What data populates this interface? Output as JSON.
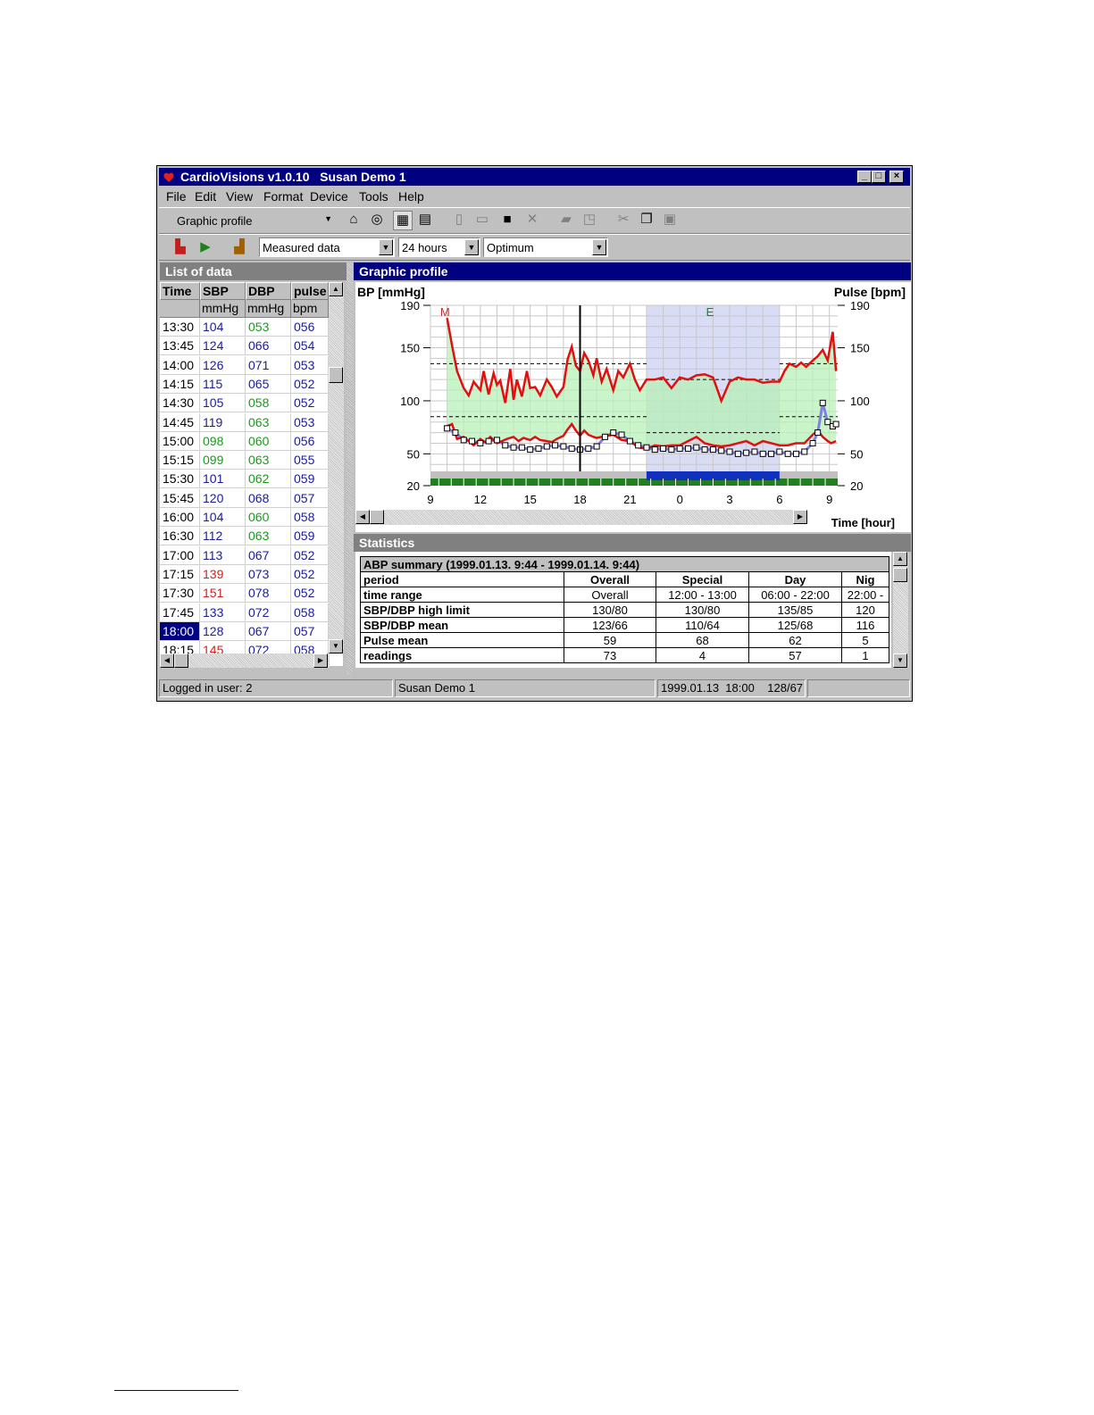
{
  "window": {
    "title": "CardioVisions v1.0.10   Susan Demo 1"
  },
  "menu": [
    "File",
    "Edit",
    "View",
    "Format",
    "Device",
    "Tools",
    "Help"
  ],
  "toolbar": {
    "view_combo": "Graphic profile",
    "data_combo": "Measured data",
    "range_combo": "24 hours",
    "limit_combo": "Optimum"
  },
  "list_panel": {
    "title": "List of data",
    "headers": [
      "Time",
      "SBP",
      "DBP",
      "pulse"
    ],
    "units": [
      "",
      "mmHg",
      "mmHg",
      "bpm"
    ],
    "rows": [
      {
        "time": "13:30",
        "sbp": "104",
        "dbp": "053",
        "pulse": "056",
        "sc": "#1a1aa0",
        "dc": "#1a9a1a"
      },
      {
        "time": "13:45",
        "sbp": "124",
        "dbp": "066",
        "pulse": "054",
        "sc": "#1a1aa0",
        "dc": "#1a1aa0"
      },
      {
        "time": "14:00",
        "sbp": "126",
        "dbp": "071",
        "pulse": "053",
        "sc": "#1a1aa0",
        "dc": "#1a1aa0"
      },
      {
        "time": "14:15",
        "sbp": "115",
        "dbp": "065",
        "pulse": "052",
        "sc": "#1a1aa0",
        "dc": "#1a1aa0"
      },
      {
        "time": "14:30",
        "sbp": "105",
        "dbp": "058",
        "pulse": "052",
        "sc": "#1a1aa0",
        "dc": "#1a9a1a"
      },
      {
        "time": "14:45",
        "sbp": "119",
        "dbp": "063",
        "pulse": "053",
        "sc": "#1a1aa0",
        "dc": "#1a9a1a"
      },
      {
        "time": "15:00",
        "sbp": "098",
        "dbp": "060",
        "pulse": "056",
        "sc": "#1a9a1a",
        "dc": "#1a9a1a"
      },
      {
        "time": "15:15",
        "sbp": "099",
        "dbp": "063",
        "pulse": "055",
        "sc": "#1a9a1a",
        "dc": "#1a9a1a"
      },
      {
        "time": "15:30",
        "sbp": "101",
        "dbp": "062",
        "pulse": "059",
        "sc": "#1a1aa0",
        "dc": "#1a9a1a"
      },
      {
        "time": "15:45",
        "sbp": "120",
        "dbp": "068",
        "pulse": "057",
        "sc": "#1a1aa0",
        "dc": "#1a1aa0"
      },
      {
        "time": "16:00",
        "sbp": "104",
        "dbp": "060",
        "pulse": "058",
        "sc": "#1a1aa0",
        "dc": "#1a9a1a"
      },
      {
        "time": "16:30",
        "sbp": "112",
        "dbp": "063",
        "pulse": "059",
        "sc": "#1a1aa0",
        "dc": "#1a9a1a"
      },
      {
        "time": "17:00",
        "sbp": "113",
        "dbp": "067",
        "pulse": "052",
        "sc": "#1a1aa0",
        "dc": "#1a1aa0"
      },
      {
        "time": "17:15",
        "sbp": "139",
        "dbp": "073",
        "pulse": "052",
        "sc": "#d02020",
        "dc": "#1a1aa0"
      },
      {
        "time": "17:30",
        "sbp": "151",
        "dbp": "078",
        "pulse": "052",
        "sc": "#d02020",
        "dc": "#1a1aa0"
      },
      {
        "time": "17:45",
        "sbp": "133",
        "dbp": "072",
        "pulse": "058",
        "sc": "#1a1aa0",
        "dc": "#1a1aa0"
      },
      {
        "time": "18:00",
        "sbp": "128",
        "dbp": "067",
        "pulse": "057",
        "sc": "#1a1aa0",
        "dc": "#1a1aa0"
      },
      {
        "time": "18:15",
        "sbp": "145",
        "dbp": "072",
        "pulse": "058",
        "sc": "#d02020",
        "dc": "#1a1aa0"
      }
    ],
    "selected_row": 16
  },
  "graph_panel": {
    "title": "Graphic profile"
  },
  "chart_data": {
    "type": "line",
    "ylabel": "BP [mmHg]",
    "y2label": "Pulse [bpm]",
    "xlabel": "Time [hour]",
    "yticks": [
      190,
      150,
      100,
      50,
      20
    ],
    "xticks": [
      "9",
      "12",
      "15",
      "18",
      "21",
      "0",
      "3",
      "6",
      "9"
    ],
    "ylim": [
      20,
      190
    ],
    "x_hours": [
      9,
      33.5
    ],
    "markers": [
      {
        "label": "M",
        "x": 9.8,
        "color": "#c03030"
      },
      {
        "label": "E",
        "x": 25.8,
        "color": "#208020"
      }
    ],
    "night_band": [
      22,
      30
    ],
    "limits": {
      "sbp_day": 135,
      "dbp_day": 85,
      "sbp_night": 120,
      "dbp_night": 70
    },
    "cursor_x": 18,
    "series": [
      {
        "name": "SBP",
        "color": "#e01010",
        "x": [
          10,
          10.3,
          10.6,
          11,
          11.3,
          11.6,
          12,
          12.2,
          12.5,
          12.8,
          13,
          13.2,
          13.5,
          13.8,
          14,
          14.2,
          14.5,
          14.8,
          15,
          15.3,
          15.6,
          16,
          16.3,
          16.6,
          17,
          17.25,
          17.5,
          17.75,
          18,
          18.25,
          18.5,
          18.8,
          19,
          19.3,
          19.6,
          20,
          20.3,
          20.6,
          21,
          21.3,
          21.6,
          22,
          22.5,
          23,
          23.5,
          24,
          24.5,
          25,
          25.5,
          26,
          26.5,
          27,
          27.5,
          28,
          28.5,
          29,
          29.5,
          30,
          30.3,
          30.6,
          31,
          31.3,
          31.6,
          32,
          32.3,
          32.6,
          32.9,
          33.2,
          33.4
        ],
        "y": [
          178,
          152,
          128,
          112,
          105,
          118,
          110,
          128,
          106,
          126,
          115,
          119,
          98,
          130,
          101,
          120,
          104,
          128,
          112,
          113,
          105,
          120,
          113,
          104,
          113,
          139,
          151,
          133,
          128,
          145,
          138,
          124,
          140,
          118,
          130,
          110,
          128,
          122,
          135,
          120,
          110,
          120,
          120,
          122,
          112,
          122,
          120,
          124,
          125,
          122,
          100,
          118,
          122,
          120,
          120,
          117,
          118,
          118,
          128,
          135,
          132,
          136,
          132,
          138,
          142,
          148,
          138,
          165,
          128
        ]
      },
      {
        "name": "DBP",
        "color": "#e01010",
        "x": [
          10,
          10.3,
          10.6,
          11,
          11.3,
          11.6,
          12,
          12.3,
          12.6,
          13,
          13.3,
          13.6,
          14,
          14.3,
          14.6,
          15,
          15.3,
          15.6,
          16,
          16.3,
          16.6,
          17,
          17.25,
          17.5,
          17.75,
          18,
          18.25,
          18.5,
          18.8,
          19,
          19.3,
          19.6,
          20,
          20.5,
          21,
          21.5,
          22,
          22.5,
          23,
          23.5,
          24,
          24.5,
          25,
          25.5,
          26,
          26.5,
          27,
          27.5,
          28,
          28.5,
          29,
          29.5,
          30,
          30.5,
          31,
          31.5,
          32,
          32.3,
          32.6,
          32.9,
          33.1,
          33.4
        ],
        "y": [
          76,
          78,
          64,
          66,
          62,
          58,
          64,
          61,
          66,
          60,
          62,
          64,
          66,
          62,
          65,
          63,
          66,
          63,
          62,
          61,
          64,
          67,
          73,
          78,
          72,
          67,
          72,
          68,
          66,
          65,
          66,
          67,
          68,
          63,
          62,
          56,
          55,
          58,
          57,
          58,
          58,
          62,
          66,
          60,
          58,
          57,
          58,
          60,
          62,
          58,
          62,
          60,
          58,
          58,
          60,
          60,
          68,
          72,
          66,
          62,
          60,
          62
        ]
      },
      {
        "name": "Pulse",
        "color": "#8080e0",
        "x": [
          10,
          10.5,
          11,
          11.5,
          12,
          12.5,
          13,
          13.5,
          14,
          14.5,
          15,
          15.5,
          16,
          16.5,
          17,
          17.5,
          18,
          18.5,
          19,
          19.5,
          20,
          20.5,
          21,
          21.5,
          22,
          22.5,
          23,
          23.5,
          24,
          24.5,
          25,
          25.5,
          26,
          26.5,
          27,
          27.5,
          28,
          28.5,
          29,
          29.5,
          30,
          30.5,
          31,
          31.5,
          32,
          32.3,
          32.6,
          32.9,
          33.2,
          33.4
        ],
        "y": [
          74,
          70,
          63,
          62,
          60,
          62,
          63,
          58,
          56,
          56,
          54,
          55,
          57,
          58,
          57,
          55,
          54,
          55,
          57,
          66,
          70,
          68,
          62,
          58,
          56,
          54,
          55,
          54,
          55,
          55,
          56,
          54,
          54,
          53,
          52,
          50,
          51,
          52,
          50,
          50,
          52,
          50,
          50,
          52,
          60,
          70,
          98,
          80,
          76,
          78
        ]
      }
    ]
  },
  "stats_panel": {
    "title": "Statistics",
    "summary": "ABP summary  (1999.01.13. 9:44 - 1999.01.14. 9:44)",
    "rows": [
      [
        "period",
        "Overall",
        "Special",
        "Day",
        "Nig"
      ],
      [
        "time range",
        "Overall",
        "12:00 - 13:00",
        "06:00 - 22:00",
        "22:00 -"
      ],
      [
        "SBP/DBP high limit",
        "130/80",
        "130/80",
        "135/85",
        "120"
      ],
      [
        "SBP/DBP mean",
        "123/66",
        "110/64",
        "125/68",
        "116"
      ],
      [
        "Pulse mean",
        "59",
        "68",
        "62",
        "5"
      ],
      [
        "readings",
        "73",
        "4",
        "57",
        "1"
      ]
    ]
  },
  "status": {
    "user": "Logged in user: 2",
    "patient": "Susan Demo 1",
    "record": "1999.01.13  18:00    128/67"
  }
}
